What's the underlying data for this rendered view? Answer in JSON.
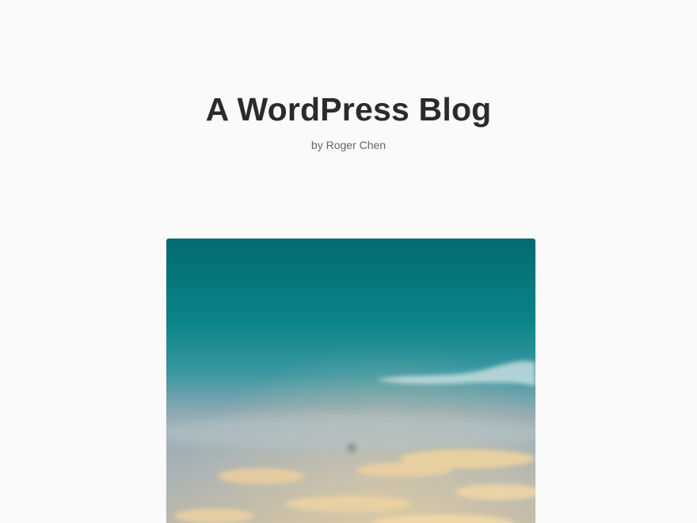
{
  "site": {
    "title": "A WordPress Blog",
    "byline": "by Roger Chen"
  },
  "hero": {
    "subject": "sky with clouds at dusk",
    "colors": {
      "sky_top": "#036a70",
      "sky_mid": "#0f8a8e",
      "sky_haze": "#8fa9b4",
      "sky_low": "#a9b4b8",
      "cloud_warm": "#f2d39a",
      "cloud_soft": "#d9e6ea"
    }
  }
}
